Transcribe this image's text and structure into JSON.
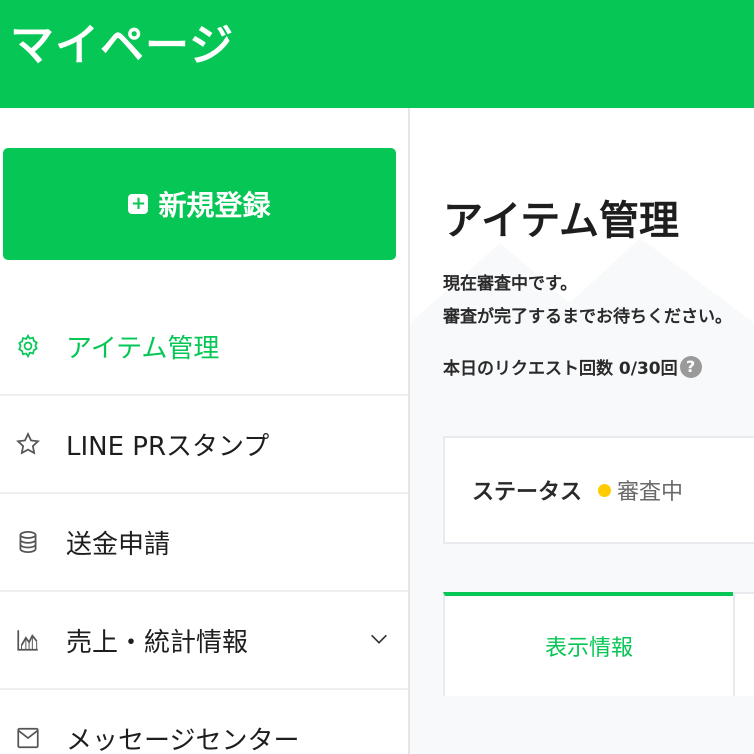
{
  "header": {
    "title": "マイページ"
  },
  "sidebar": {
    "new_button": {
      "icon": "plus-icon",
      "label": "新規登録"
    },
    "items": [
      {
        "icon": "gear-icon",
        "label": "アイテム管理",
        "active": true
      },
      {
        "icon": "star-icon",
        "label": "LINE PRスタンプ",
        "active": false
      },
      {
        "icon": "coin-stack-icon",
        "label": "送金申請",
        "active": false
      },
      {
        "icon": "chart-icon",
        "label": "売上・統計情報",
        "active": false,
        "expandable": true
      },
      {
        "icon": "envelope-icon",
        "label": "メッセージセンター",
        "active": false
      }
    ]
  },
  "main": {
    "title": "アイテム管理",
    "status_line1": "現在審査中です。",
    "status_line2": "審査が完了するまでお待ちください。",
    "request_count_label": "本日のリクエスト回数 0/30回",
    "help_icon": "?",
    "status_card": {
      "label": "ステータス",
      "value": "審査中",
      "dot_color": "#ffcc00"
    },
    "tabs": [
      {
        "label": "表示情報",
        "active": true
      }
    ]
  },
  "colors": {
    "brand": "#06c755",
    "text": "#1e1e1e",
    "border": "#e8eaee"
  }
}
